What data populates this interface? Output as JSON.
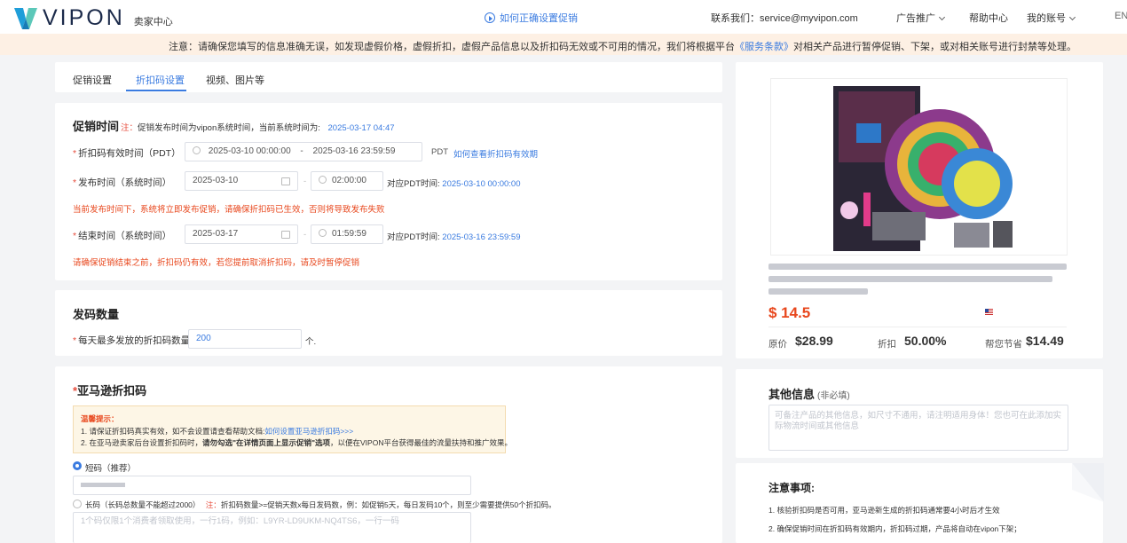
{
  "header": {
    "logo_text": "VIPON",
    "logo_sub": "卖家中心",
    "howto_link": "如何正确设置促销",
    "contact": "联系我们：service@myvipon.com",
    "nav": [
      "广告推广",
      "帮助中心",
      "我的账号"
    ],
    "lang": "EN"
  },
  "notice": {
    "pre": "注意：请确保您填写的信息准确无误，如发现虚假价格，虚假折扣，虚假产品信息以及折扣码无效或不可用的情况，我们将根据平台",
    "link": "《服务条款》",
    "post": "对相关产品进行暂停促销、下架，或对相关账号进行封禁等处理。"
  },
  "tabs": [
    "促销设置",
    "折扣码设置",
    "视频、图片等"
  ],
  "promo_time": {
    "title": "促销时间",
    "note_prefix": "注：",
    "note": "促销发布时间为vipon系统时间，当前系统时间为:",
    "current_time": "2025-03-17  04:47",
    "validity_label": "折扣码有效时间（PDT）",
    "validity_start": "2025-03-10 00:00:00",
    "validity_sep": "-",
    "validity_end": "2025-03-16 23:59:59",
    "pdt": "PDT",
    "validity_link": "如何查看折扣码有效期",
    "publish_label": "发布时间（系统时间）",
    "publish_date": "2025-03-10",
    "publish_time": "02:00:00",
    "publish_pdt_label": "对应PDT时间:",
    "publish_pdt_value": "2025-03-10 00:00:00",
    "publish_warning": "当前发布时间下，系统将立即发布促销，请确保折扣码已生效，否则将导致发布失败",
    "end_label": "结束时间（系统时间）",
    "end_date": "2025-03-17",
    "end_time": "01:59:59",
    "end_pdt_label": "对应PDT时间:",
    "end_pdt_value": "2025-03-16  23:59:59",
    "end_warning": "请确保促销结束之前，折扣码仍有效，若您提前取消折扣码，请及时暂停促销"
  },
  "quantity": {
    "title": "发码数量",
    "label": "每天最多发放的折扣码数量为",
    "value": "200",
    "unit": "个."
  },
  "amazon": {
    "title": "亚马逊折扣码",
    "tip_title": "温馨提示：",
    "tip1_pre": "1. 请保证折扣码真实有效，如不会设置请查看帮助文档:",
    "tip1_link": "如何设置亚马逊折扣码>>>",
    "tip2_pre": "2. 在亚马逊卖家后台设置折扣码时，",
    "tip2_bold": "请勿勾选\"在详情页面上显示促销\"选项",
    "tip2_post": "，以便在VIPON平台获得最佳的流量扶持和推广效果。",
    "short_label": "短码（推荐）",
    "long_label": "长码（长码总数量不能超过2000）",
    "long_note_prefix": "注：",
    "long_note": "折扣码数量>=促销天数x每日发码数，例：如促销5天，每日发码10个，则至少需要提供50个折扣码。",
    "long_placeholder": "1个码仅限1个消费者领取使用，一行1码，例如：L9YR-LD9UKM-NQ4TS6，一行一码"
  },
  "product": {
    "price": "$ 14.5",
    "orig_label": "原价",
    "orig_value": "$28.99",
    "discount_label": "折扣",
    "discount_value": "50.00%",
    "save_label": "帮您节省",
    "save_value": "$14.49"
  },
  "other_info": {
    "title": "其他信息",
    "optional": "(非必填)",
    "placeholder": "可备注产品的其他信息，如尺寸不通用，请注明适用身体！您也可在此添加实际物流时间或其他信息"
  },
  "notes": {
    "title": "注意事项:",
    "items": [
      "1. 核验折扣码是否可用，亚马逊新生成的折扣码通常要4小时后才生效",
      "2. 确保促销时间在折扣码有效期内，折扣码过期，产品将自动在vipon下架；"
    ]
  },
  "colors": {
    "accent": "#3a7be0",
    "price": "#e8471d",
    "warning": "#e74c3c",
    "notice_bg": "#fdf0e4"
  }
}
